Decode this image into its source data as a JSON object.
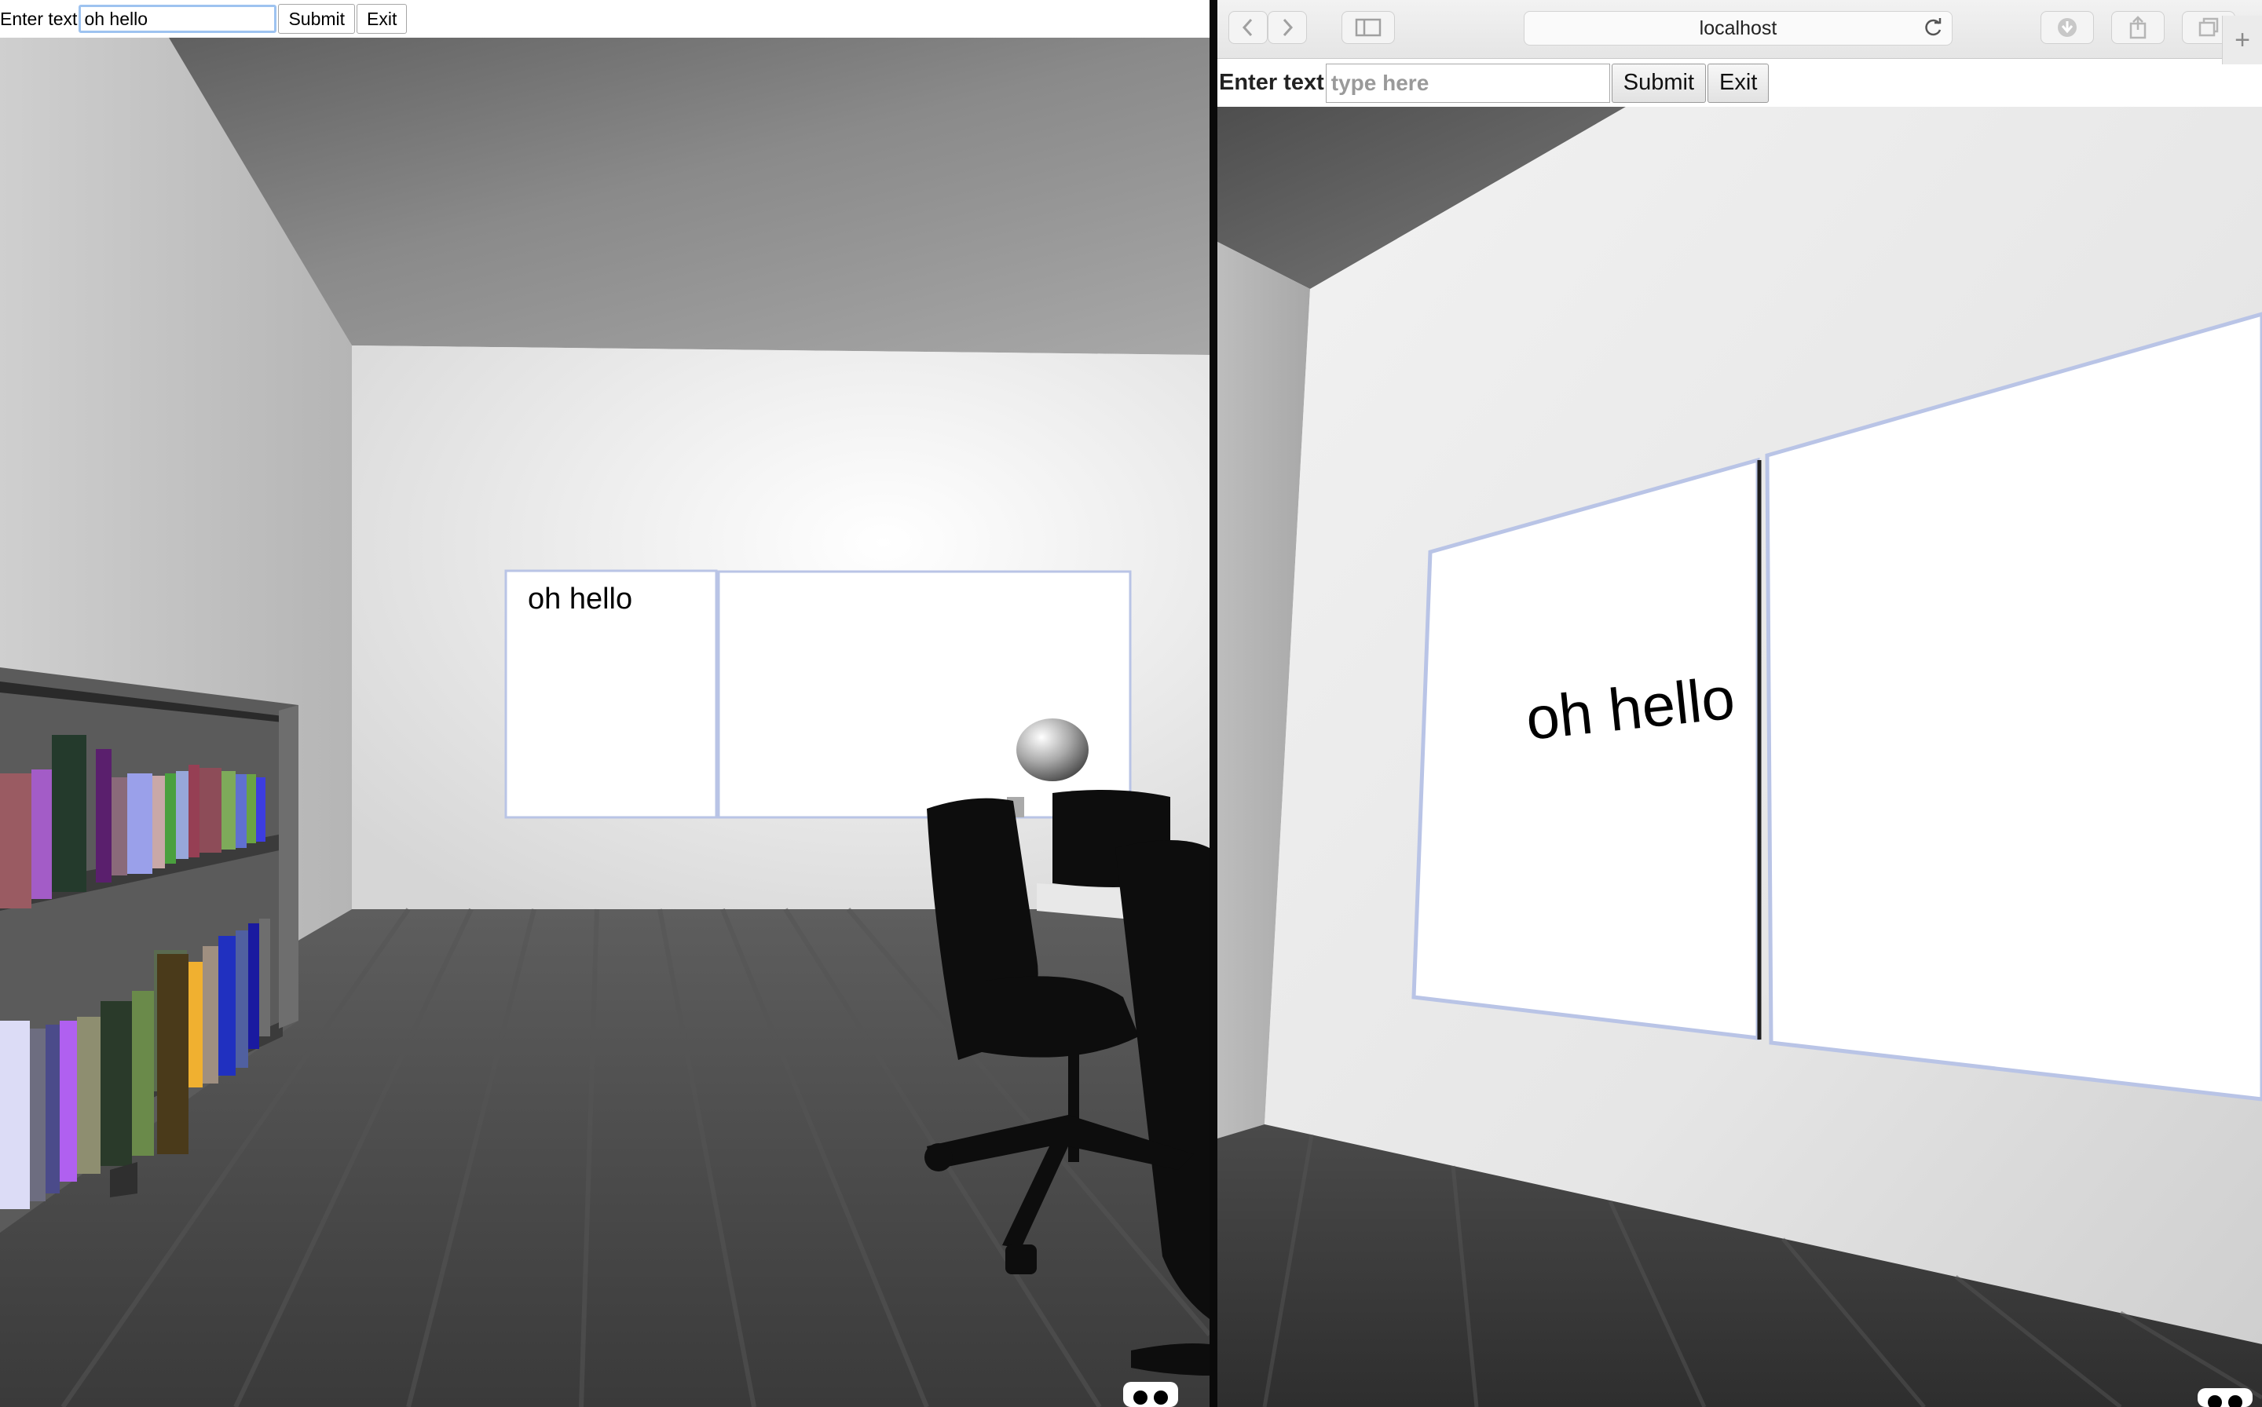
{
  "left_app": {
    "form": {
      "label": "Enter text",
      "input_value": "oh hello",
      "submit_label": "Submit",
      "exit_label": "Exit"
    },
    "whiteboard_text": "oh hello"
  },
  "right_browser": {
    "address": "localhost",
    "new_tab_label": "+",
    "form": {
      "label": "Enter text",
      "input_placeholder": "type here",
      "submit_label": "Submit",
      "exit_label": "Exit"
    },
    "whiteboard_text": "oh hello"
  },
  "icons": [
    "back-arrow-icon",
    "forward-arrow-icon",
    "sidebar-icon",
    "reload-icon",
    "download-icon",
    "share-icon",
    "tabs-icon",
    "vr-goggles-icon"
  ],
  "colors": {
    "ceiling": "#6f6f6f",
    "wall": "#e9e9e9",
    "floor": "#4a4a4a",
    "whiteboard_frame": "#b9c4e6",
    "input_focus": "#9ec3f0"
  }
}
